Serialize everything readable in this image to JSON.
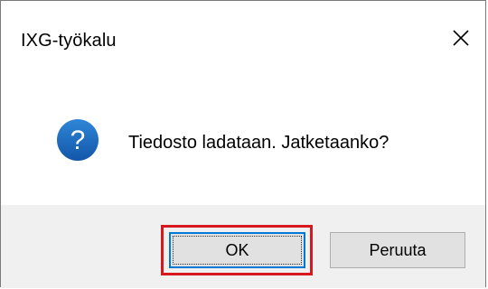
{
  "dialog": {
    "title": "IXG-työkalu",
    "close_icon": "close-icon",
    "message_icon": "question-icon",
    "message": "Tiedosto ladataan. Jatketaanko?",
    "buttons": {
      "ok_label": "OK",
      "cancel_label": "Peruuta"
    },
    "colors": {
      "icon_blue": "#1565c0",
      "focus_ring": "#d7191f",
      "default_button_border": "#0078d7",
      "footer_background": "#f0f0f0"
    }
  }
}
